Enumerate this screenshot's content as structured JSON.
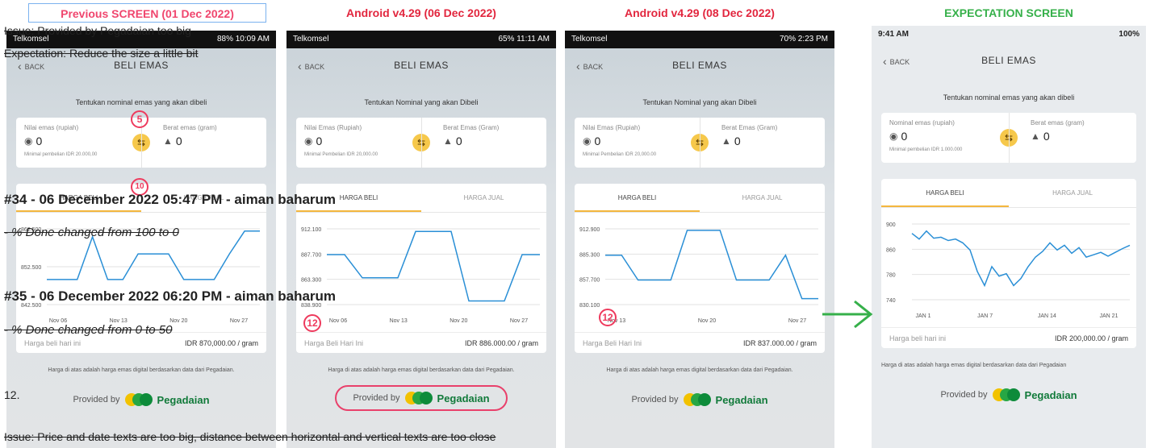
{
  "titles": {
    "previous": "Previous SCREEN (01 Dec 2022)",
    "android_a": "Android v4.29 (06 Dec 2022)",
    "android_b": "Android v4.29 (08 Dec 2022)",
    "expectation": "EXPECTATION SCREEN"
  },
  "colors": {
    "accent_red": "#e2263e",
    "accent_green": "#36b04a",
    "tab_underline": "#f4b73e",
    "marker": "#ee3a5d"
  },
  "phones": [
    {
      "status_left": "Telkomsel",
      "status_right": "88% 10:09 AM",
      "back": "BACK",
      "title": "BELI EMAS",
      "prompt": "Tentukan nominal emas yang akan dibeli",
      "left_label": "Nilai emas (rupiah)",
      "left_value": "0",
      "right_label": "Berat emas (gram)",
      "right_value": "0",
      "minimal": "Minimal pembelian IDR 20.000,00",
      "tab_buy": "HARGA BELI",
      "tab_sell": "HARGA JUAL",
      "y_ticks": [
        "862.500",
        "852.500",
        "842.500"
      ],
      "x_ticks": [
        "Nov 06",
        "Nov 13",
        "Nov 20",
        "Nov 27"
      ],
      "price_label": "Harga beli hari ini",
      "price_value": "IDR 870,000.00 / gram",
      "disclaimer": "Harga di atas adalah harga emas digital berdasarkan data dari Pegadaian.",
      "provided": "Provided by",
      "brand": "Pegadaian"
    },
    {
      "status_left": "Telkomsel",
      "status_right": "65% 11:11 AM",
      "back": "BACK",
      "title": "BELI EMAS",
      "prompt": "Tentukan Nominal yang akan Dibeli",
      "left_label": "Nilai Emas (Rupiah)",
      "left_value": "0",
      "right_label": "Berat Emas (Gram)",
      "right_value": "0",
      "minimal": "Minimal Pembelian IDR 20,000.00",
      "tab_buy": "HARGA BELI",
      "tab_sell": "HARGA JUAL",
      "y_ticks": [
        "912.100",
        "887.700",
        "863.300",
        "838.900"
      ],
      "x_ticks": [
        "Nov 06",
        "Nov 13",
        "Nov 20",
        "Nov 27"
      ],
      "price_label": "Harga Beli Hari Ini",
      "price_value": "IDR 886.000.00 / gram",
      "disclaimer": "Harga di atas adalah harga emas digital berdasarkan data dari Pegadaian.",
      "provided": "Provided by",
      "brand": "Pegadaian"
    },
    {
      "status_left": "Telkomsel",
      "status_right": "70% 2:23 PM",
      "back": "BACK",
      "title": "BELI EMAS",
      "prompt": "Tentukan Nominal yang akan Dibeli",
      "left_label": "Nilai Emas (Rupiah)",
      "left_value": "0",
      "right_label": "Berat Emas (Gram)",
      "right_value": "0",
      "minimal": "Minimal Pembelian IDR 20,000.00",
      "tab_buy": "HARGA BELI",
      "tab_sell": "HARGA JUAL",
      "y_ticks": [
        "912.900",
        "885.300",
        "857.700",
        "830.100"
      ],
      "x_ticks": [
        "Nov 13",
        "Nov 20",
        "Nov 27"
      ],
      "price_label": "Harga Beli Hari Ini",
      "price_value": "IDR 837.000.00 / gram",
      "disclaimer": "Harga di atas adalah harga emas digital berdasarkan data dari Pegadaian.",
      "provided": "Provided by",
      "brand": "Pegadaian"
    },
    {
      "status_left": "9:41 AM",
      "status_right": "100%",
      "back": "BACK",
      "title": "BELI EMAS",
      "prompt": "Tentukan nominal emas yang akan dibeli",
      "left_label": "Nominal emas (rupiah)",
      "left_value": "0",
      "right_label": "Berat emas (gram)",
      "right_value": "0",
      "minimal": "Minimal pembelian IDR 1.000.000",
      "tab_buy": "HARGA BELI",
      "tab_sell": "HARGA JUAL",
      "y_ticks": [
        "900",
        "860",
        "780",
        "740"
      ],
      "x_ticks": [
        "JAN 1",
        "JAN 7",
        "JAN 14",
        "JAN 21"
      ],
      "price_label": "Harga beli hari ini",
      "price_value": "IDR 200,000.00 / gram",
      "disclaimer": "Harga di atas adalah harga emas digital berdasarkan data dari Pegadaian",
      "provided": "Provided by",
      "brand": "Pegadaian"
    }
  ],
  "markers": {
    "m5": "5",
    "m10": "10",
    "m12a": "12",
    "m12b": "12"
  },
  "overlay": {
    "issue1": "Issue: Provided by Pegadaian too big",
    "expectation": "Expectation: Reduce the size a little bit",
    "journal34": "#34 - 06 December 2022 05:47 PM - aiman baharum",
    "done34": "- % Done changed from 100 to 0",
    "journal35": "#35 - 06 December 2022 06:20 PM - aiman baharum",
    "done35": "- % Done changed from 0 to 50",
    "item": "12.",
    "issue2": "Issue: Price and date texts are too big, distance between horizontal and vertical texts are too close"
  },
  "chart_data": [
    {
      "type": "line",
      "series": [
        {
          "values": [
            853,
            853,
            853,
            868,
            853,
            853,
            862,
            862,
            862,
            853,
            853,
            853,
            862,
            870,
            870
          ]
        }
      ],
      "ylim": [
        842.5,
        872.5
      ]
    },
    {
      "type": "line",
      "series": [
        {
          "values": [
            887.7,
            887.7,
            863.3,
            863.3,
            863.3,
            912.1,
            912.1,
            912.1,
            838.9,
            838.9,
            838.9,
            887.7,
            887.7
          ]
        }
      ],
      "ylim": [
        830,
        920
      ]
    },
    {
      "type": "line",
      "series": [
        {
          "values": [
            885.3,
            885.3,
            857.7,
            857.7,
            857.7,
            912.9,
            912.9,
            912.9,
            857.7,
            857.7,
            857.7,
            885.3,
            837,
            837
          ]
        }
      ],
      "ylim": [
        825,
        920
      ]
    },
    {
      "type": "line",
      "series": [
        {
          "values": [
            880,
            868,
            885,
            870,
            872,
            865,
            868,
            860,
            845,
            800,
            770,
            810,
            790,
            795,
            770,
            785,
            810,
            830,
            842,
            860,
            845,
            855,
            838,
            850,
            830,
            835,
            840,
            832,
            840,
            848,
            855
          ]
        }
      ],
      "ylim": [
        730,
        910
      ]
    }
  ]
}
